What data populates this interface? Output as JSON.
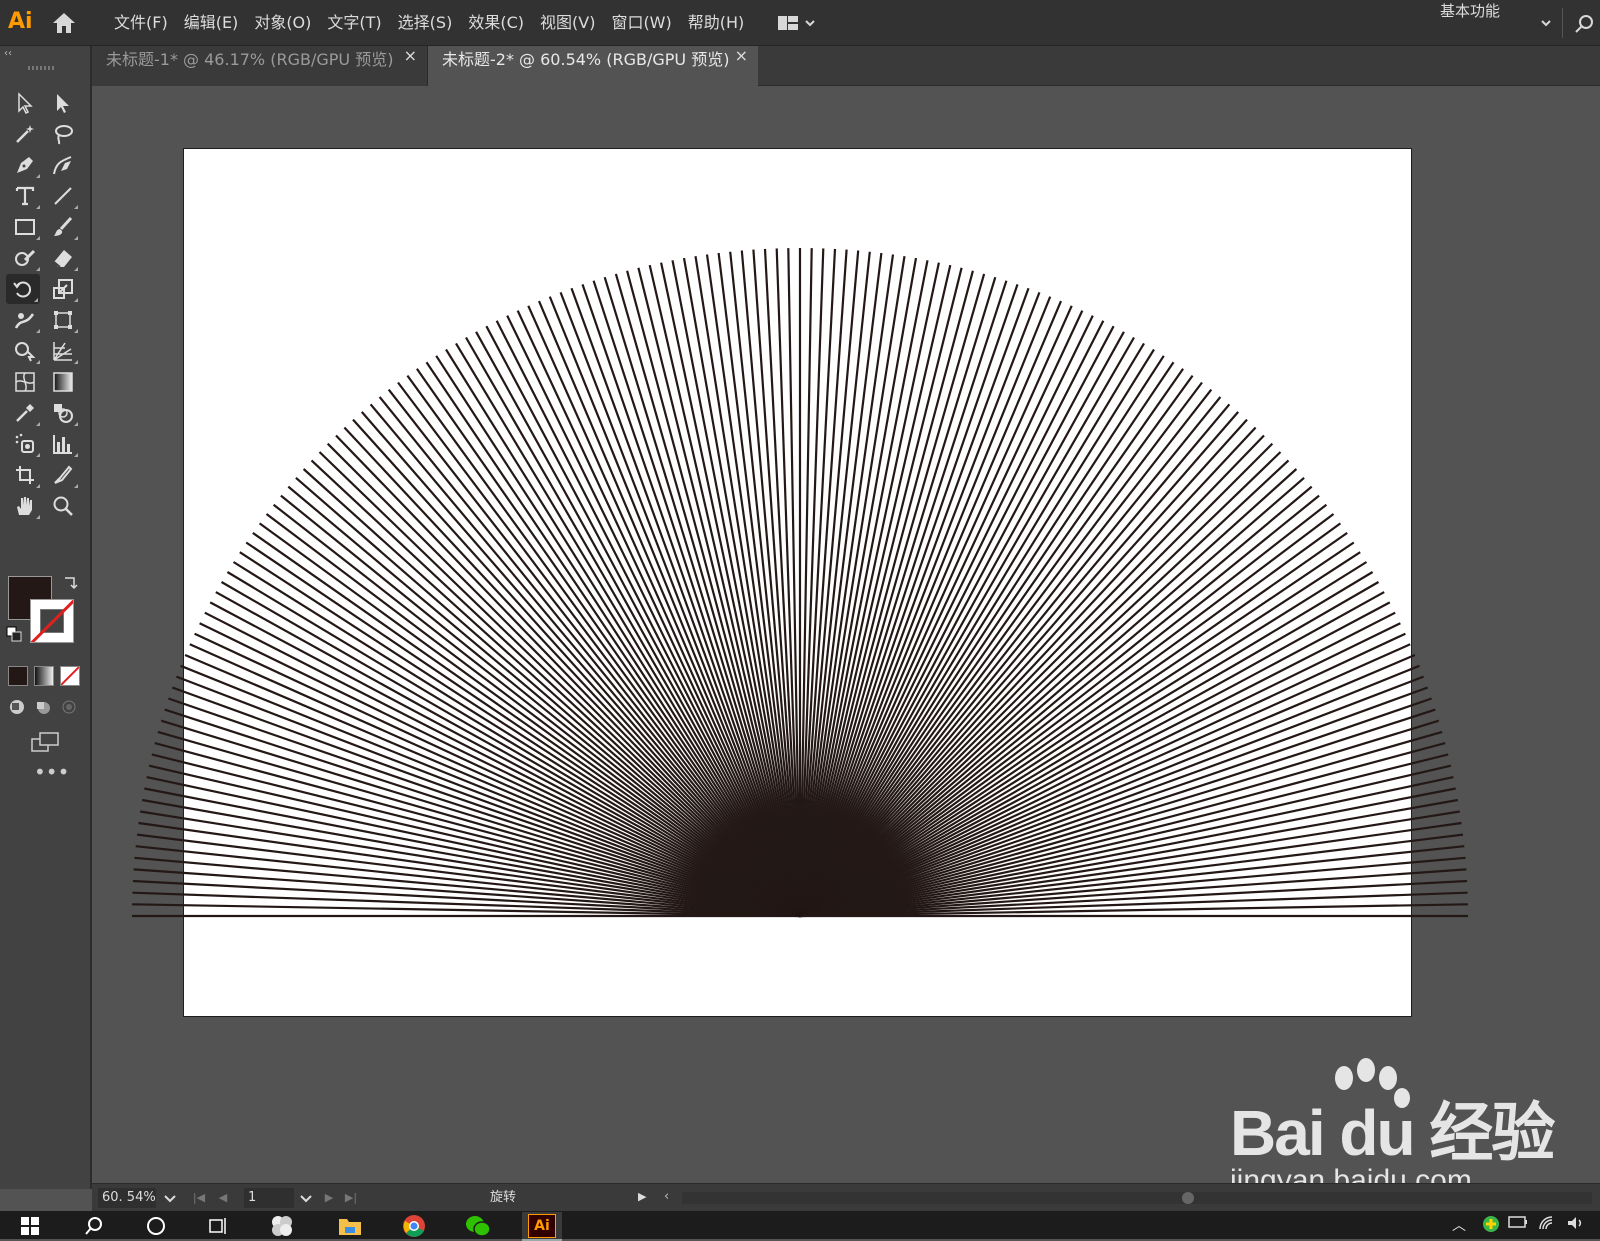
{
  "app": {
    "logo_text": "Ai"
  },
  "menu": {
    "items": [
      "文件(F)",
      "编辑(E)",
      "对象(O)",
      "文字(T)",
      "选择(S)",
      "效果(C)",
      "视图(V)",
      "窗口(W)",
      "帮助(H)"
    ],
    "workspace": "基本功能"
  },
  "tabs": [
    {
      "label": "未标题-1* @ 46.17% (RGB/GPU 预览)",
      "close": "×",
      "active": false
    },
    {
      "label": "未标题-2* @ 60.54% (RGB/GPU 预览)",
      "close": "×",
      "active": true
    }
  ],
  "tools": {
    "left_column": [
      "selection-tool",
      "magic-wand-tool",
      "pen-tool",
      "type-tool",
      "rectangle-tool",
      "shaper-tool",
      "rotate-tool",
      "warp-tool",
      "shape-builder-tool",
      "mesh-tool",
      "eyedropper-tool",
      "symbol-sprayer-tool",
      "artboard-tool",
      "hand-tool"
    ],
    "right_column": [
      "direct-selection-tool",
      "lasso-tool",
      "curvature-tool",
      "line-segment-tool",
      "paintbrush-tool",
      "eraser-tool",
      "scale-tool",
      "free-transform-tool",
      "perspective-grid-tool",
      "gradient-tool",
      "blend-tool",
      "column-graph-tool",
      "slice-tool",
      "zoom-tool"
    ],
    "active": "rotate-tool",
    "more": "•••"
  },
  "colors": {
    "fill": "#231815",
    "stroke": "none",
    "accent": "#ff9a00",
    "artwork_stroke": "#231815"
  },
  "artwork": {
    "type": "radial-line-fan",
    "line_count": 180,
    "sweep_degrees": 180
  },
  "status": {
    "zoom": "60. 54%",
    "page": "1",
    "current_tool": "旋转"
  },
  "watermark": {
    "brand": "Bai du 经验",
    "url": "jingyan.baidu.com"
  }
}
